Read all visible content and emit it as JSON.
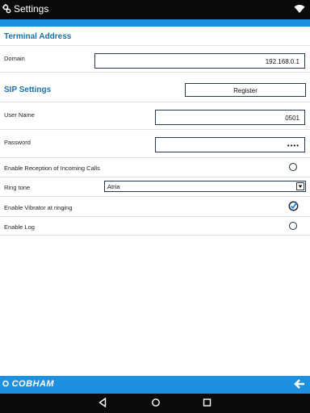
{
  "statusbar": {
    "title": "Settings",
    "app_icon": "gears-icon",
    "wifi_icon": "wifi-icon"
  },
  "terminal": {
    "section_title": "Terminal Address",
    "domain_label": "Domain",
    "domain_value": "192.168.0.1"
  },
  "sip": {
    "section_title": "SIP Settings",
    "register_label": "Register",
    "username_label": "User Name",
    "username_value": "0501",
    "password_label": "Password",
    "password_value": "••••"
  },
  "options": {
    "incoming_label": "Enable Reception of Incoming Calls",
    "incoming_checked": false,
    "ringtone_label": "Ring tone",
    "ringtone_value": "Atria",
    "vibrator_label": "Enable Vibrator at ringing",
    "vibrator_checked": true,
    "log_label": "Enable Log",
    "log_checked": false
  },
  "footer": {
    "logo": "COBHAM",
    "back_icon": "arrow-left-icon"
  },
  "navbar": {
    "back_icon": "nav-back-icon",
    "home_icon": "nav-home-icon",
    "recents_icon": "nav-recents-icon"
  },
  "colors": {
    "accent": "#1e90e0",
    "section_title": "#1a6fa8",
    "bar": "#0a0a0a"
  }
}
